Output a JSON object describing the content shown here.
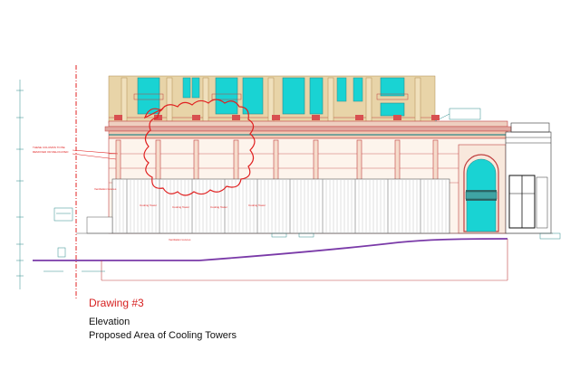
{
  "drawing": {
    "annotations": {
      "columns_note_line1": "THESE COLUMNS TO BE",
      "columns_note_line2": "REMOVED OR RELOCATED",
      "tower_labels": [
        "Cooling Tower",
        "Cooling Tower",
        "Cooling Tower",
        "Cooling Tower"
      ],
      "ventilation_left": "Ventilation louvres",
      "ventilation_bottom": "Ventilation louvres"
    },
    "colors": {
      "outline_red": "#d24040",
      "glass_cyan": "#19d3d3",
      "facade_tan": "#e8d4a8",
      "ground_purple": "#7a3aa8",
      "cloud_red": "#e02020"
    }
  },
  "caption": {
    "number": "Drawing #3",
    "line1": "Elevation",
    "line2": "Proposed Area of Cooling Towers"
  }
}
